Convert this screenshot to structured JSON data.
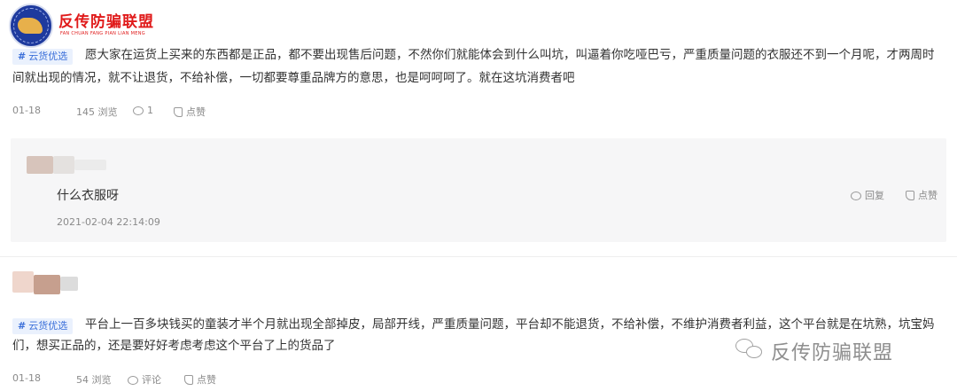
{
  "logo": {
    "title": "反传防骗联盟",
    "subtitle": "FAN CHUAN FANG PIAN LIAN MENG"
  },
  "posts": [
    {
      "tag": "云货优选",
      "text_line1": "愿大家在运货上买来的东西都是正品，都不要出现售后问题，不然你们就能体会到什么叫坑，叫逼着你吃哑巴亏，严重质量问题的衣服还不到一个月呢，才两周时",
      "text_line2": "间就出现的情况，就不让退货，不给补偿，一切都要尊重品牌方的意思，也是呵呵呵了。就在这坑消费者吧",
      "date": "01-18",
      "views": "145 浏览",
      "comments": "1",
      "like_label": "点赞"
    },
    {
      "tag": "云货优选",
      "text_line1": "平台上一百多块钱买的童装才半个月就出现全部掉皮，局部开线，严重质量问题，平台却不能退货，不给补偿，不维护消费者利益，这个平台就是在坑熟，坑宝妈",
      "text_line2": "们，想买正品的，还是要好好考虑考虑这个平台了上的货品了",
      "date": "01-18",
      "views": "54 浏览",
      "comments": "评论",
      "like_label": "点赞"
    }
  ],
  "reply": {
    "text": "什么衣服呀",
    "timestamp": "2021-02-04 22:14:09",
    "reply_label": "回复",
    "like_label": "点赞"
  },
  "watermark": {
    "text": "反传防骗联盟"
  },
  "colors": {
    "tag_bg": "#eaf1fd",
    "tag_text": "#3b6fd9",
    "logo_red": "#e01a1a",
    "reply_bg": "#f6f6f7"
  }
}
